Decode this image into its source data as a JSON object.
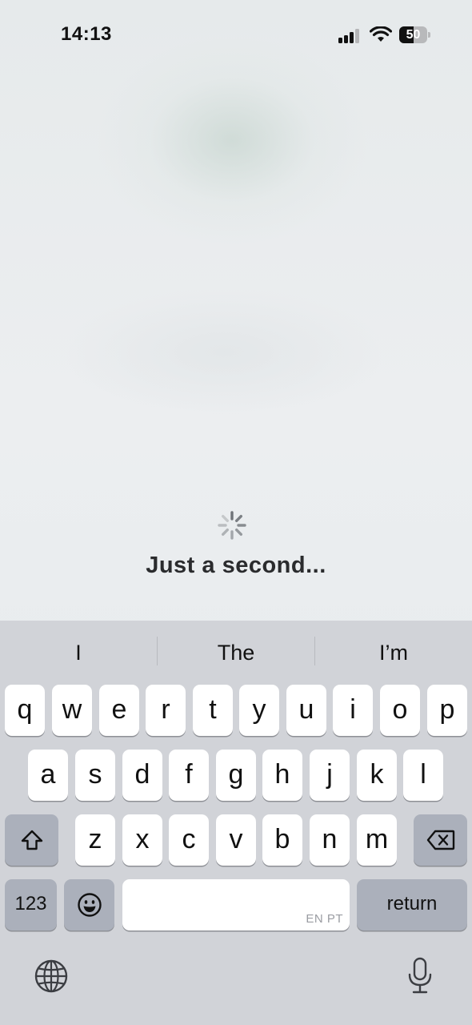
{
  "status_bar": {
    "time": "14:13",
    "battery_percent": "50",
    "battery_level": 0.5,
    "signal_bars": 3
  },
  "main": {
    "loading_text": "Just a second..."
  },
  "keyboard": {
    "suggestions": [
      "I",
      "The",
      "I’m"
    ],
    "row1": [
      "q",
      "w",
      "e",
      "r",
      "t",
      "y",
      "u",
      "i",
      "o",
      "p"
    ],
    "row2": [
      "a",
      "s",
      "d",
      "f",
      "g",
      "h",
      "j",
      "k",
      "l"
    ],
    "row3": [
      "z",
      "x",
      "c",
      "v",
      "b",
      "n",
      "m"
    ],
    "numbers_label": "123",
    "return_label": "return",
    "space_lang_tag": "EN PT",
    "icons": {
      "shift": "shift-icon",
      "delete": "delete-icon",
      "emoji": "emoji-icon",
      "globe": "globe-icon",
      "mic": "microphone-icon"
    }
  }
}
